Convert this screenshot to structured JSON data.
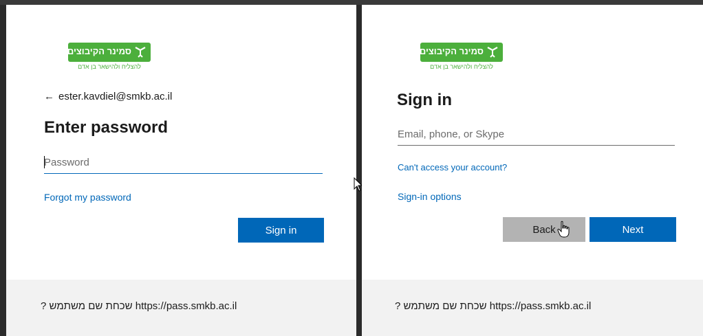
{
  "brand": {
    "logo_main": "סמינר הקיבוצים",
    "logo_sub": "להצליח ולהישאר בן אדם",
    "logo_color": "#4caf3c"
  },
  "left_panel": {
    "back_arrow_icon": "←",
    "email": "ester.kavdiel@smkb.ac.il",
    "title": "Enter password",
    "password_placeholder": "Password",
    "password_value": "",
    "forgot_link": "Forgot my password",
    "sign_in_button": "Sign in",
    "footer_text": "? שכחת שם משתמש https://pass.smkb.ac.il"
  },
  "right_panel": {
    "title": "Sign in",
    "email_placeholder": "Email, phone, or Skype",
    "email_value": "",
    "cant_access_link": "Can't access your account?",
    "signin_options_link": "Sign-in options",
    "back_button": "Back",
    "next_button": "Next",
    "footer_text": "? שכחת שם משתמש https://pass.smkb.ac.il"
  },
  "colors": {
    "accent": "#0067b8",
    "footer_bg": "#f2f2f2",
    "secondary_button": "#b3b3b3"
  }
}
